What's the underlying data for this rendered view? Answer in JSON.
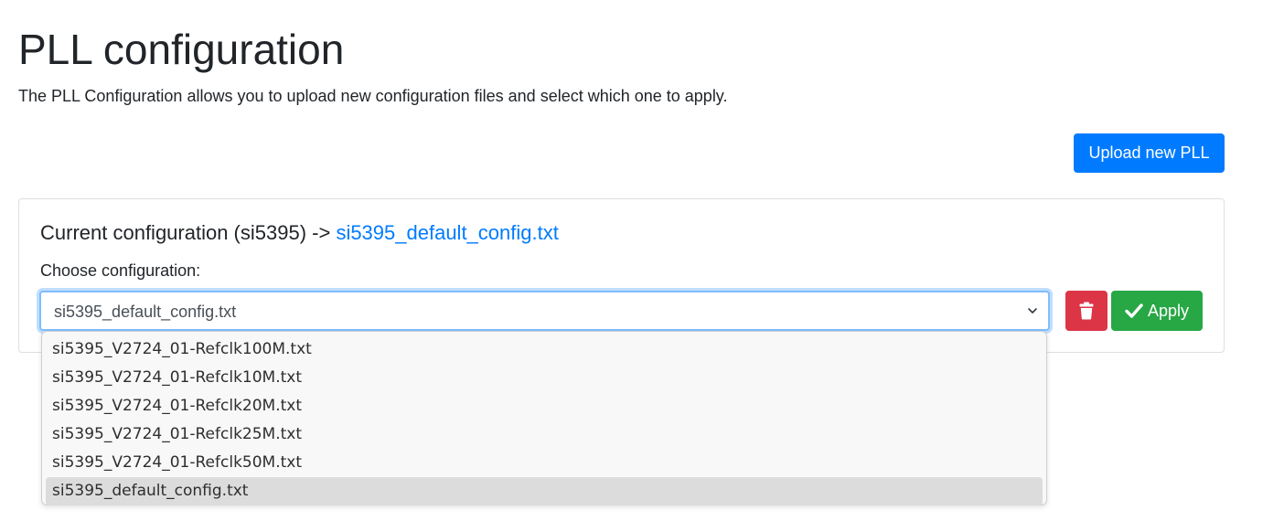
{
  "page": {
    "title": "PLL configuration",
    "description": "The PLL Configuration allows you to upload new configuration files and select which one to apply."
  },
  "toolbar": {
    "upload_label": "Upload new PLL"
  },
  "config_card": {
    "heading_prefix": "Current configuration (si5395) -> ",
    "current_file": "si5395_default_config.txt",
    "choose_label": "Choose configuration:",
    "selected_value": "si5395_default_config.txt",
    "apply_label": "Apply",
    "delete_icon": "trash-icon",
    "apply_icon": "check-icon",
    "select_icon": "chevron-down-icon"
  },
  "dropdown": {
    "options": [
      "si5395_V2724_01-Refclk100M.txt",
      "si5395_V2724_01-Refclk10M.txt",
      "si5395_V2724_01-Refclk20M.txt",
      "si5395_V2724_01-Refclk25M.txt",
      "si5395_V2724_01-Refclk50M.txt",
      "si5395_default_config.txt"
    ],
    "selected_index": 5
  },
  "colors": {
    "primary": "#007bff",
    "danger": "#dc3545",
    "success": "#28a745",
    "focus_border": "#80bdff"
  }
}
